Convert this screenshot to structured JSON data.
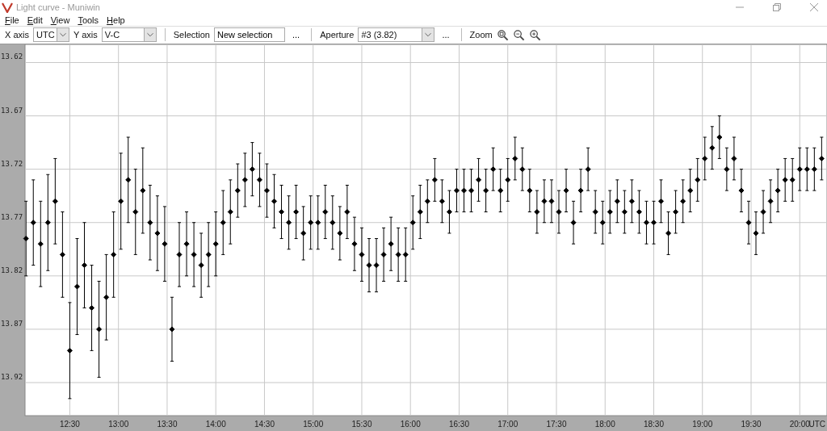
{
  "window": {
    "title": "Light curve - Muniwin"
  },
  "menu": [
    {
      "label": "File"
    },
    {
      "label": "Edit"
    },
    {
      "label": "View"
    },
    {
      "label": "Tools"
    },
    {
      "label": "Help"
    }
  ],
  "toolbar": {
    "x_axis": {
      "label": "X axis",
      "value": "UTC"
    },
    "y_axis": {
      "label": "Y axis",
      "value": "V-C"
    },
    "selection": {
      "label": "Selection",
      "value": "New selection",
      "more": "..."
    },
    "aperture": {
      "label": "Aperture",
      "value": "#3 (3.82)",
      "more": "..."
    },
    "zoom": {
      "label": "Zoom"
    }
  },
  "chart_data": {
    "type": "scatter",
    "grid": true,
    "xlabel": "UTC",
    "xlim": [
      12.04,
      20.28
    ],
    "ylim": [
      13.951,
      13.603
    ],
    "xticks": [
      {
        "value": 12.5,
        "label": "12:30"
      },
      {
        "value": 13,
        "label": "13:00"
      },
      {
        "value": 13.5,
        "label": "13:30"
      },
      {
        "value": 14,
        "label": "14:00"
      },
      {
        "value": 14.5,
        "label": "14:30"
      },
      {
        "value": 15,
        "label": "15:00"
      },
      {
        "value": 15.5,
        "label": "15:30"
      },
      {
        "value": 16,
        "label": "16:00"
      },
      {
        "value": 16.5,
        "label": "16:30"
      },
      {
        "value": 17,
        "label": "17:00"
      },
      {
        "value": 17.5,
        "label": "17:30"
      },
      {
        "value": 18,
        "label": "18:00"
      },
      {
        "value": 18.5,
        "label": "18:30"
      },
      {
        "value": 19,
        "label": "19:00"
      },
      {
        "value": 19.5,
        "label": "19:30"
      },
      {
        "value": 20,
        "label": "20:00"
      }
    ],
    "yticks": [
      13.62,
      13.67,
      13.72,
      13.77,
      13.82,
      13.87,
      13.92
    ],
    "x": [
      12.05,
      12.125,
      12.2,
      12.275,
      12.35,
      12.425,
      12.5,
      12.575,
      12.65,
      12.725,
      12.8,
      12.875,
      12.95,
      13.025,
      13.1,
      13.175,
      13.25,
      13.325,
      13.4,
      13.475,
      13.55,
      13.625,
      13.7,
      13.775,
      13.85,
      13.925,
      14,
      14.075,
      14.15,
      14.225,
      14.3,
      14.375,
      14.45,
      14.525,
      14.6,
      14.675,
      14.75,
      14.825,
      14.9,
      14.975,
      15.05,
      15.125,
      15.2,
      15.275,
      15.35,
      15.425,
      15.5,
      15.575,
      15.65,
      15.725,
      15.8,
      15.875,
      15.95,
      16.025,
      16.1,
      16.175,
      16.25,
      16.325,
      16.4,
      16.475,
      16.55,
      16.625,
      16.7,
      16.775,
      16.85,
      16.925,
      17,
      17.075,
      17.15,
      17.225,
      17.3,
      17.375,
      17.45,
      17.525,
      17.6,
      17.675,
      17.75,
      17.825,
      17.9,
      17.975,
      18.05,
      18.125,
      18.2,
      18.275,
      18.35,
      18.425,
      18.5,
      18.575,
      18.65,
      18.725,
      18.8,
      18.875,
      18.95,
      19.025,
      19.1,
      19.175,
      19.25,
      19.325,
      19.4,
      19.475,
      19.55,
      19.625,
      19.7,
      19.775,
      19.85,
      19.925,
      20,
      20.075,
      20.15,
      20.225
    ],
    "series": [
      {
        "color": "#000000",
        "values": [
          13.785,
          13.77,
          13.79,
          13.77,
          13.75,
          13.8,
          13.89,
          13.83,
          13.81,
          13.85,
          13.87,
          13.84,
          13.8,
          13.75,
          13.73,
          13.76,
          13.74,
          13.77,
          13.78,
          13.79,
          13.87,
          13.8,
          13.79,
          13.8,
          13.81,
          13.8,
          13.79,
          13.77,
          13.76,
          13.74,
          13.73,
          13.72,
          13.73,
          13.74,
          13.75,
          13.76,
          13.77,
          13.76,
          13.78,
          13.77,
          13.77,
          13.76,
          13.77,
          13.78,
          13.76,
          13.79,
          13.8,
          13.81,
          13.81,
          13.8,
          13.79,
          13.8,
          13.8,
          13.77,
          13.76,
          13.75,
          13.73,
          13.75,
          13.76,
          13.74,
          13.74,
          13.74,
          13.73,
          13.74,
          13.72,
          13.74,
          13.73,
          13.71,
          13.72,
          13.74,
          13.76,
          13.75,
          13.75,
          13.76,
          13.74,
          13.77,
          13.74,
          13.72,
          13.76,
          13.77,
          13.76,
          13.75,
          13.76,
          13.75,
          13.76,
          13.77,
          13.77,
          13.75,
          13.78,
          13.76,
          13.75,
          13.74,
          13.73,
          13.71,
          13.7,
          13.69,
          13.72,
          13.71,
          13.74,
          13.77,
          13.78,
          13.76,
          13.75,
          13.74,
          13.73,
          13.73,
          13.72,
          13.72,
          13.72,
          13.71
        ],
        "errors": [
          0.035,
          0.04,
          0.04,
          0.045,
          0.04,
          0.04,
          0.045,
          0.045,
          0.04,
          0.04,
          0.045,
          0.04,
          0.04,
          0.045,
          0.04,
          0.04,
          0.04,
          0.035,
          0.035,
          0.035,
          0.03,
          0.03,
          0.03,
          0.03,
          0.03,
          0.03,
          0.03,
          0.03,
          0.03,
          0.025,
          0.025,
          0.025,
          0.025,
          0.025,
          0.025,
          0.025,
          0.025,
          0.025,
          0.025,
          0.025,
          0.025,
          0.025,
          0.025,
          0.025,
          0.025,
          0.025,
          0.025,
          0.025,
          0.025,
          0.025,
          0.025,
          0.025,
          0.025,
          0.025,
          0.025,
          0.02,
          0.02,
          0.02,
          0.02,
          0.02,
          0.02,
          0.02,
          0.02,
          0.02,
          0.02,
          0.02,
          0.02,
          0.02,
          0.02,
          0.02,
          0.02,
          0.02,
          0.02,
          0.02,
          0.02,
          0.02,
          0.02,
          0.02,
          0.02,
          0.02,
          0.02,
          0.02,
          0.02,
          0.02,
          0.02,
          0.02,
          0.02,
          0.02,
          0.02,
          0.02,
          0.02,
          0.02,
          0.02,
          0.02,
          0.02,
          0.02,
          0.02,
          0.02,
          0.02,
          0.02,
          0.02,
          0.02,
          0.02,
          0.02,
          0.02,
          0.02,
          0.02,
          0.02,
          0.02,
          0.02
        ]
      }
    ]
  }
}
